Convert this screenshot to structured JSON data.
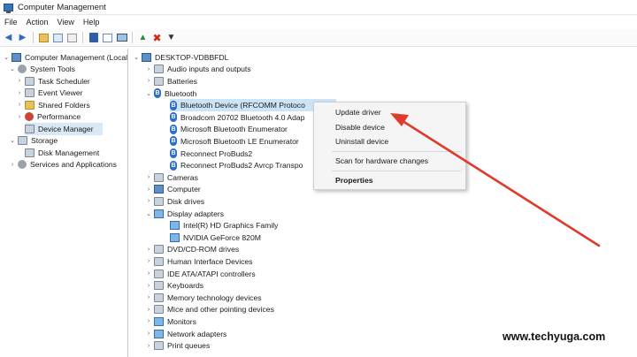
{
  "window": {
    "title": "Computer Management"
  },
  "menubar": {
    "items": [
      "File",
      "Action",
      "View",
      "Help"
    ]
  },
  "left_tree": {
    "root": "Computer Management (Local",
    "system_tools": "System Tools",
    "items": [
      "Task Scheduler",
      "Event Viewer",
      "Shared Folders",
      "Performance",
      "Device Manager"
    ],
    "storage": "Storage",
    "disk_management": "Disk Management",
    "services": "Services and Applications"
  },
  "device_tree": {
    "computer_name": "DESKTOP-VDBBFDL",
    "categories_top": [
      "Audio inputs and outputs",
      "Batteries"
    ],
    "bluetooth": "Bluetooth",
    "bluetooth_devices": [
      "Bluetooth Device (RFCOMM Protoco",
      "Broadcom 20702 Bluetooth 4.0 Adap",
      "Microsoft Bluetooth Enumerator",
      "Microsoft Bluetooth LE Enumerator",
      "Reconnect ProBuds2",
      "Reconnect ProBuds2 Avrcp Transpo"
    ],
    "categories_mid": [
      "Cameras",
      "Computer",
      "Disk drives"
    ],
    "display_adapters": "Display adapters",
    "display_devices": [
      "Intel(R) HD Graphics Family",
      "NVIDIA GeForce 820M"
    ],
    "categories_bottom": [
      "DVD/CD-ROM drives",
      "Human Interface Devices",
      "IDE ATA/ATAPI controllers",
      "Keyboards",
      "Memory technology devices",
      "Mice and other pointing devices",
      "Monitors",
      "Network adapters",
      "Print queues"
    ]
  },
  "context_menu": {
    "update_driver": "Update driver",
    "disable_device": "Disable device",
    "uninstall_device": "Uninstall device",
    "scan": "Scan for hardware changes",
    "properties": "Properties"
  },
  "watermark": "www.techyuga.com",
  "colors": {
    "arrow": "#e03a2e",
    "selection": "#cce4f7",
    "bluetooth_icon": "#2a6fd0"
  }
}
